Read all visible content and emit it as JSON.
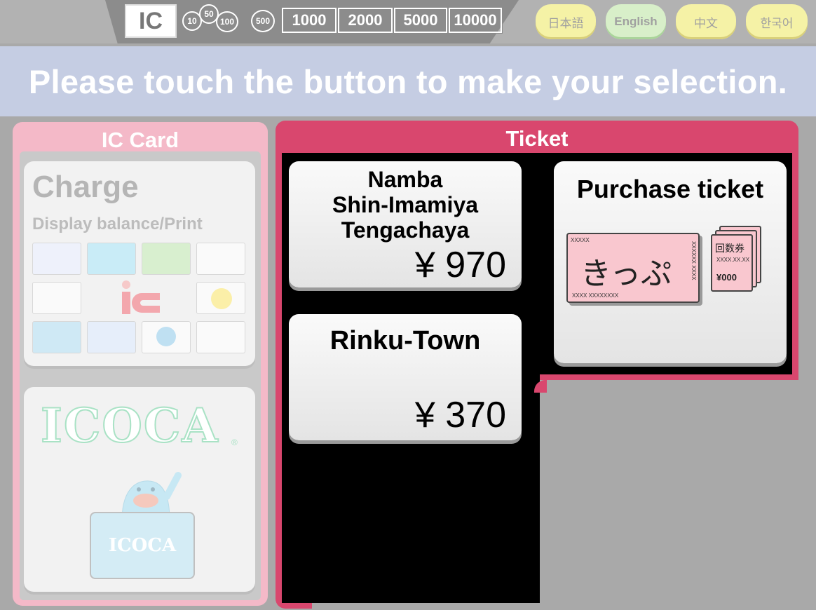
{
  "topbar": {
    "ic_label": "IC",
    "coins": [
      "10",
      "50",
      "100",
      "500"
    ],
    "bills": [
      "1000",
      "2000",
      "5000",
      "10000"
    ],
    "languages": [
      {
        "label": "日本語",
        "active": false
      },
      {
        "label": "English",
        "active": true
      },
      {
        "label": "中文",
        "active": false
      },
      {
        "label": "한국어",
        "active": false
      }
    ]
  },
  "banner": {
    "text": "Please touch the button to make your selection."
  },
  "ic_card": {
    "title": "IC Card",
    "charge": {
      "title": "Charge",
      "subtitle": "Display balance/Print"
    },
    "icoca": {
      "logo": "ICOCA",
      "reg": "®",
      "card_text": "ICOCA"
    }
  },
  "ticket": {
    "title": "Ticket",
    "fares": [
      {
        "destination_lines": [
          "Namba",
          "Shin-Imamiya",
          "Tengachaya"
        ],
        "price": "¥ 970"
      },
      {
        "destination_lines": [
          "Rinku-Town"
        ],
        "price": "¥ 370"
      }
    ],
    "purchase": {
      "title": "Purchase ticket",
      "ticket_text": "きっぷ",
      "ticket_small_top": "XXXXX",
      "ticket_small_bottom": "XXXX XXXXXXXX",
      "ticket_side": "XXXXXX XXXX",
      "coupon_label": "回数券",
      "coupon_small": "XXXX.XX.XX",
      "coupon_price": "¥000"
    }
  },
  "colors": {
    "pink": "#d9476e",
    "light_pink": "#f4b9c8",
    "banner": "#c5cde3"
  }
}
